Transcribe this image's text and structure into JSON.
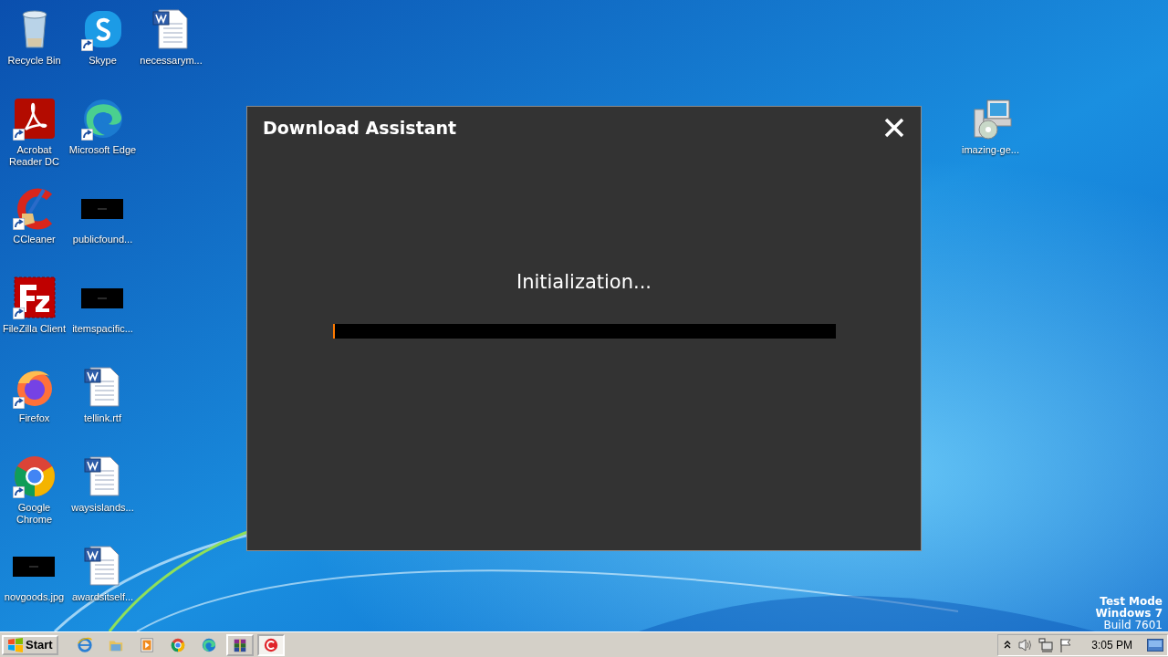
{
  "desktop": {
    "icons": [
      {
        "kind": "recycle",
        "label": "Recycle Bin",
        "shortcut": false
      },
      {
        "kind": "pdf",
        "label": "Acrobat Reader DC",
        "shortcut": true
      },
      {
        "kind": "cleaner",
        "label": "CCleaner",
        "shortcut": true
      },
      {
        "kind": "ftp",
        "label": "FileZilla Client",
        "shortcut": true
      },
      {
        "kind": "fox",
        "label": "Firefox",
        "shortcut": true
      },
      {
        "kind": "chrome",
        "label": "Google Chrome",
        "shortcut": true
      },
      {
        "kind": "thumb",
        "label": "novgoods.jpg",
        "shortcut": false
      },
      {
        "kind": "chat",
        "label": "Skype",
        "shortcut": true
      },
      {
        "kind": "edge",
        "label": "Microsoft Edge",
        "shortcut": true
      },
      {
        "kind": "thumb",
        "label": "publicfound...",
        "shortcut": false
      },
      {
        "kind": "thumb",
        "label": "itemspacific...",
        "shortcut": false
      },
      {
        "kind": "doc",
        "label": "tellink.rtf",
        "shortcut": false
      },
      {
        "kind": "doc",
        "label": "waysislands...",
        "shortcut": false
      },
      {
        "kind": "doc",
        "label": "awardsitself...",
        "shortcut": false
      },
      {
        "kind": "doc",
        "label": "necessarym...",
        "shortcut": false
      }
    ],
    "extra_icon": {
      "kind": "installer",
      "label": "imazing-ge...",
      "shortcut": false
    },
    "system_text": [
      "Test Mode",
      "Windows 7",
      "Build 7601"
    ]
  },
  "dialog": {
    "title": "Download Assistant",
    "status": "Initialization...",
    "progress": {
      "level": 0.005
    }
  },
  "taskbar": {
    "start": "Start",
    "apps": [
      {
        "kind": "ie",
        "open": false,
        "selected": false
      },
      {
        "kind": "folder",
        "open": false,
        "selected": false
      },
      {
        "kind": "media",
        "open": false,
        "selected": false
      },
      {
        "kind": "chrome",
        "open": false,
        "selected": false
      },
      {
        "kind": "edge",
        "open": false,
        "selected": false
      },
      {
        "kind": "archive",
        "open": true,
        "selected": false
      },
      {
        "kind": "redc",
        "open": true,
        "selected": true
      }
    ],
    "clock": "3:05 PM"
  }
}
